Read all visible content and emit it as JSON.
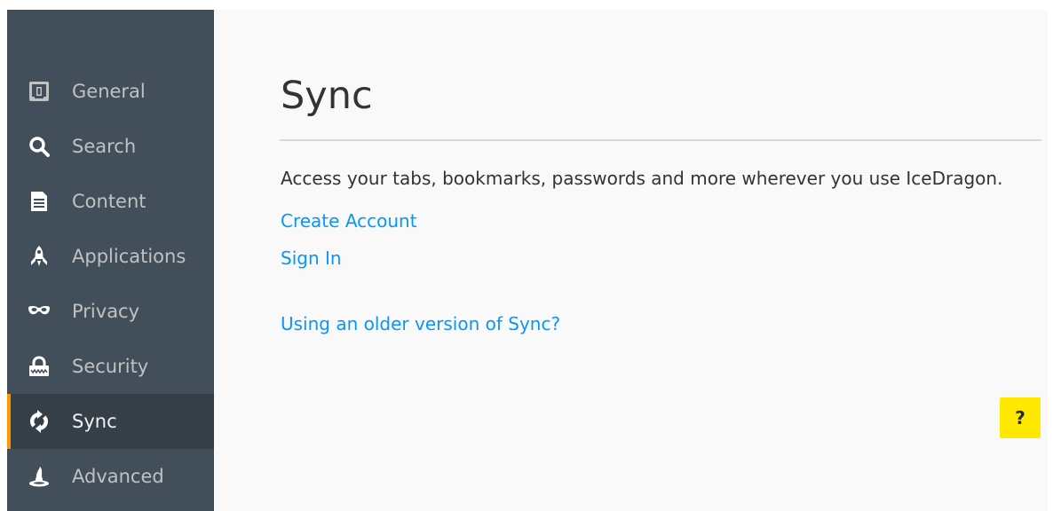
{
  "sidebar": {
    "items": [
      {
        "label": "General",
        "icon": "general-icon",
        "selected": false
      },
      {
        "label": "Search",
        "icon": "search-icon",
        "selected": false
      },
      {
        "label": "Content",
        "icon": "content-icon",
        "selected": false
      },
      {
        "label": "Applications",
        "icon": "applications-icon",
        "selected": false
      },
      {
        "label": "Privacy",
        "icon": "privacy-icon",
        "selected": false
      },
      {
        "label": "Security",
        "icon": "security-icon",
        "selected": false
      },
      {
        "label": "Sync",
        "icon": "sync-icon",
        "selected": true
      },
      {
        "label": "Advanced",
        "icon": "advanced-icon",
        "selected": false
      }
    ]
  },
  "main": {
    "title": "Sync",
    "description": "Access your tabs, bookmarks, passwords and more wherever you use IceDragon.",
    "create_account_label": "Create Account",
    "sign_in_label": "Sign In",
    "older_version_label": "Using an older version of Sync?",
    "help_label": "?"
  },
  "colors": {
    "sidebar_bg": "#424f5a",
    "sidebar_selected_bg": "#343f48",
    "selected_accent": "#ff9500",
    "link": "#0996f8",
    "help_button": "#ffe900"
  }
}
